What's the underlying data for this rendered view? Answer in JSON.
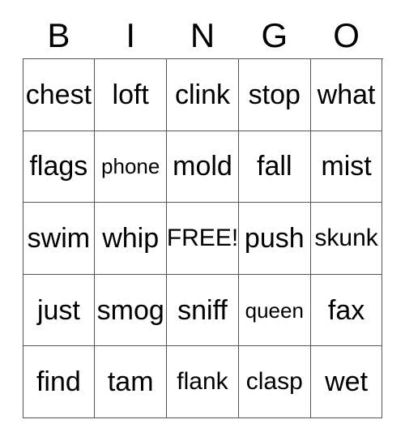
{
  "card": {
    "header_letters": [
      "B",
      "I",
      "N",
      "G",
      "O"
    ],
    "free_space_label": "FREE!",
    "text_color": "#000000",
    "border_color": "#555555",
    "background_color": "#ffffff",
    "rows": [
      [
        {
          "label": "chest",
          "size": "normal"
        },
        {
          "label": "loft",
          "size": "normal"
        },
        {
          "label": "clink",
          "size": "normal"
        },
        {
          "label": "stop",
          "size": "normal"
        },
        {
          "label": "what",
          "size": "normal"
        }
      ],
      [
        {
          "label": "flags",
          "size": "normal"
        },
        {
          "label": "phone",
          "size": "small"
        },
        {
          "label": "mold",
          "size": "normal"
        },
        {
          "label": "fall",
          "size": "normal"
        },
        {
          "label": "mist",
          "size": "normal"
        }
      ],
      [
        {
          "label": "swim",
          "size": "normal"
        },
        {
          "label": "whip",
          "size": "normal"
        },
        {
          "label": "FREE!",
          "size": "med"
        },
        {
          "label": "push",
          "size": "normal"
        },
        {
          "label": "skunk",
          "size": "med"
        }
      ],
      [
        {
          "label": "just",
          "size": "normal"
        },
        {
          "label": "smog",
          "size": "normal"
        },
        {
          "label": "sniff",
          "size": "normal"
        },
        {
          "label": "queen",
          "size": "small"
        },
        {
          "label": "fax",
          "size": "normal"
        }
      ],
      [
        {
          "label": "find",
          "size": "normal"
        },
        {
          "label": "tam",
          "size": "normal"
        },
        {
          "label": "flank",
          "size": "med"
        },
        {
          "label": "clasp",
          "size": "med"
        },
        {
          "label": "wet",
          "size": "normal"
        }
      ]
    ]
  }
}
